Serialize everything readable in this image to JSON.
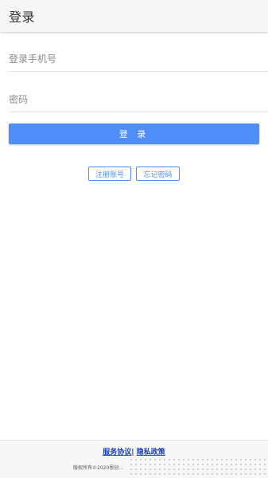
{
  "header": {
    "title": "登录"
  },
  "form": {
    "phone_placeholder": "登录手机号",
    "password_placeholder": "密码",
    "login_label": "登 录"
  },
  "links": {
    "register_label": "注册账号",
    "forgot_label": "忘记密码"
  },
  "footer": {
    "service_agreement": "服务协议",
    "separator": "|",
    "privacy_policy": "隐私政策",
    "copyright": "版权所有©2020恩创..."
  },
  "colors": {
    "accent": "#4f8ef7",
    "footer_link": "#1a3fb5"
  }
}
